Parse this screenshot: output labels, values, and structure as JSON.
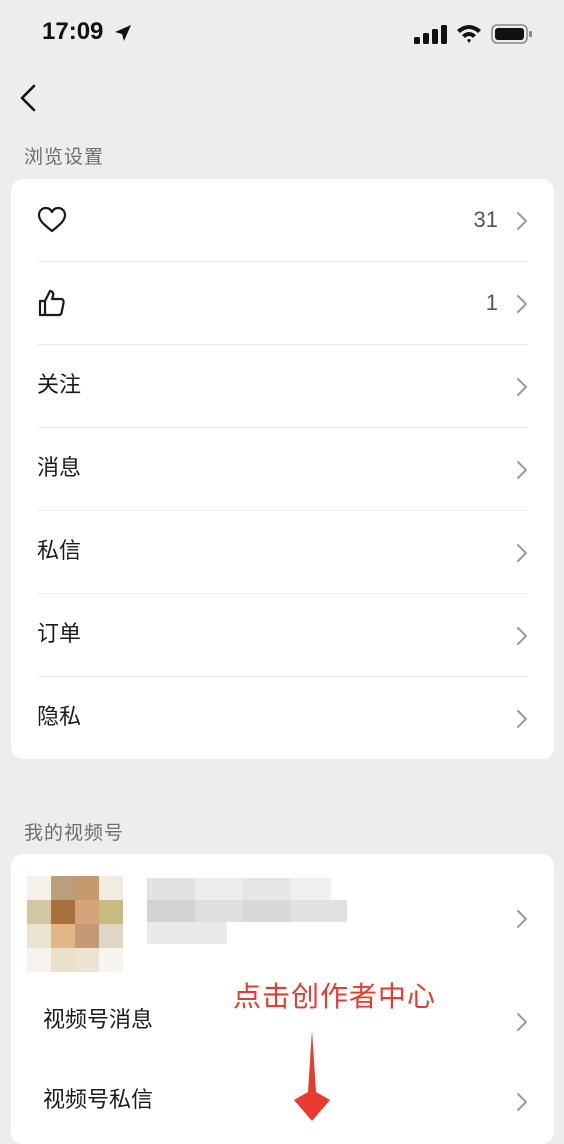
{
  "status_bar": {
    "time": "17:09",
    "icons": [
      "location-arrow-icon",
      "signal-icon",
      "wifi-icon",
      "battery-icon"
    ]
  },
  "nav": {
    "back_icon": "chevron-left-icon"
  },
  "browse_settings": {
    "title": "浏览设置",
    "items": [
      {
        "icon": "heart-icon",
        "label": "",
        "count": "31"
      },
      {
        "icon": "thumbs-up-icon",
        "label": "",
        "count": "1"
      },
      {
        "label": "关注",
        "count": ""
      },
      {
        "label": "消息",
        "count": ""
      },
      {
        "label": "私信",
        "count": ""
      },
      {
        "label": "订单",
        "count": ""
      },
      {
        "label": "隐私",
        "count": ""
      }
    ]
  },
  "my_channels": {
    "title": "我的视频号",
    "items": [
      {
        "label": "视频号消息"
      },
      {
        "label": "视频号私信"
      }
    ]
  },
  "annotation": {
    "text": "点击创作者中心",
    "color": "#e83a2e"
  },
  "colors": {
    "background": "#ededed",
    "card": "#ffffff",
    "secondary_text": "#6e6e6e",
    "annotation_red": "#e83a2e"
  }
}
